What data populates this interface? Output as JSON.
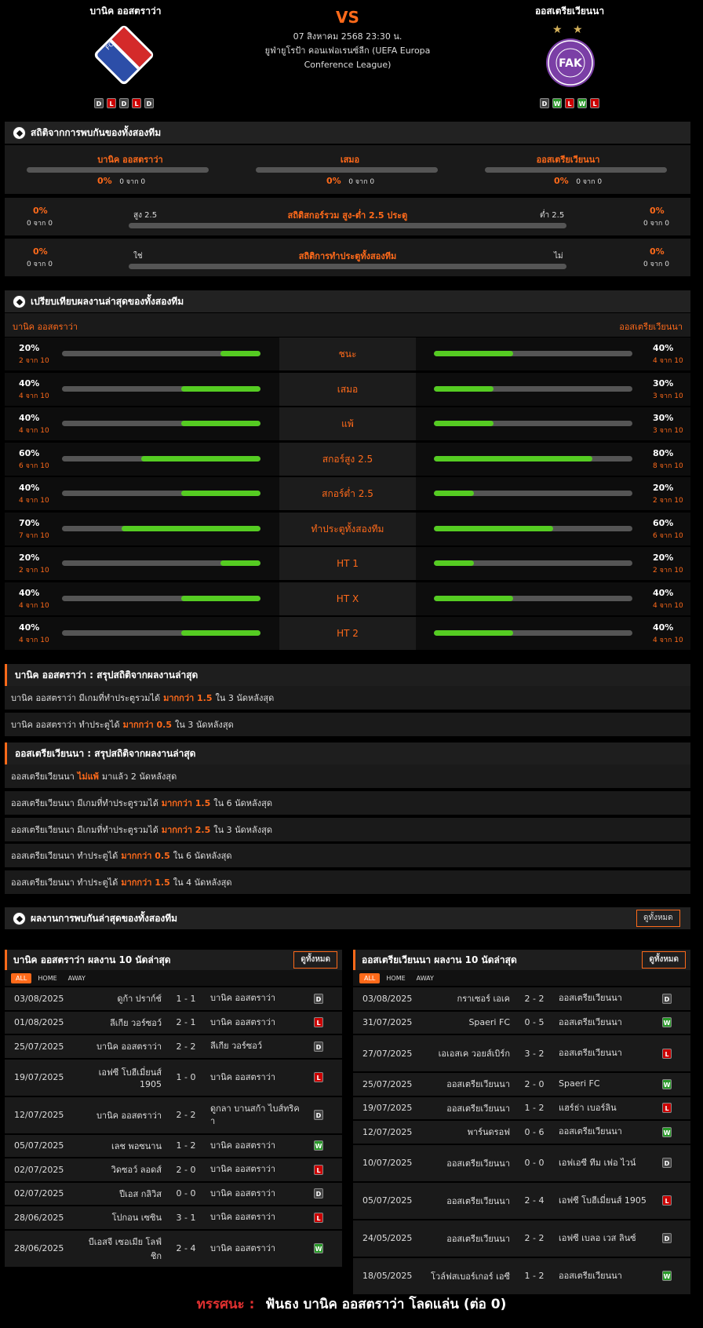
{
  "header": {
    "home_name": "บานิค ออสตราว่า",
    "away_name": "ออสเตรียเวียนนา",
    "vs": "VS",
    "date": "07 สิงหาคม 2568 23:30 น.",
    "league": "ยูฟ่ายูโรป้า คอนเฟอเรนซ์ลีก (UEFA Europa Conference League)",
    "home_form": [
      "D",
      "L",
      "D",
      "L",
      "D"
    ],
    "away_form": [
      "D",
      "W",
      "L",
      "W",
      "L"
    ],
    "home_logo_text": "FC BANÍK OSTRAVA",
    "away_logo_text": "FAK"
  },
  "h2h": {
    "title": "สถิติจากการพบกันของทั้งสองทีม",
    "home_label": "บานิค ออสตราว่า",
    "draw_label": "เสมอ",
    "away_label": "ออสเตรียเวียนนา",
    "home_pct": "0%",
    "home_cnt": "0 จาก 0",
    "draw_pct": "0%",
    "draw_cnt": "0 จาก 0",
    "away_pct": "0%",
    "away_cnt": "0 จาก 0",
    "ou": {
      "title": "สถิติสกอร์รวม สูง-ต่ำ 2.5 ประตู",
      "left_pct": "0%",
      "left_cnt": "0 จาก 0",
      "right_pct": "0%",
      "right_cnt": "0 จาก 0",
      "left_lbl": "สูง 2.5",
      "right_lbl": "ต่ำ 2.5"
    },
    "btts": {
      "title": "สถิติการทำประตูทั้งสองทีม",
      "left_pct": "0%",
      "left_cnt": "0 จาก 0",
      "right_pct": "0%",
      "right_cnt": "0 จาก 0",
      "left_lbl": "ใช่",
      "right_lbl": "ไม่"
    }
  },
  "compare": {
    "title": "เปรียบเทียบผลงานล่าสุดของทั้งสองทีม",
    "home": "บานิค ออสตราว่า",
    "away": "ออสเตรียเวียนนา",
    "rows": [
      {
        "label": "ชนะ",
        "lp": "20%",
        "lc": "2 จาก 10",
        "lv": 0.2,
        "rp": "40%",
        "rc": "4 จาก 10",
        "rv": 0.4
      },
      {
        "label": "เสมอ",
        "lp": "40%",
        "lc": "4 จาก 10",
        "lv": 0.4,
        "rp": "30%",
        "rc": "3 จาก 10",
        "rv": 0.3
      },
      {
        "label": "แพ้",
        "lp": "40%",
        "lc": "4 จาก 10",
        "lv": 0.4,
        "rp": "30%",
        "rc": "3 จาก 10",
        "rv": 0.3
      },
      {
        "label": "สกอร์สูง 2.5",
        "lp": "60%",
        "lc": "6 จาก 10",
        "lv": 0.6,
        "rp": "80%",
        "rc": "8 จาก 10",
        "rv": 0.8
      },
      {
        "label": "สกอร์ต่ำ 2.5",
        "lp": "40%",
        "lc": "4 จาก 10",
        "lv": 0.4,
        "rp": "20%",
        "rc": "2 จาก 10",
        "rv": 0.2
      },
      {
        "label": "ทำประตูทั้งสองทีม",
        "lp": "70%",
        "lc": "7 จาก 10",
        "lv": 0.7,
        "rp": "60%",
        "rc": "6 จาก 10",
        "rv": 0.6
      },
      {
        "label": "HT 1",
        "lp": "20%",
        "lc": "2 จาก 10",
        "lv": 0.2,
        "rp": "20%",
        "rc": "2 จาก 10",
        "rv": 0.2
      },
      {
        "label": "HT X",
        "lp": "40%",
        "lc": "4 จาก 10",
        "lv": 0.4,
        "rp": "40%",
        "rc": "4 จาก 10",
        "rv": 0.4
      },
      {
        "label": "HT 2",
        "lp": "40%",
        "lc": "4 จาก 10",
        "lv": 0.4,
        "rp": "40%",
        "rc": "4 จาก 10",
        "rv": 0.4
      }
    ]
  },
  "summary_home": {
    "title": "บานิค ออสตราว่า : สรุปสถิติจากผลงานล่าสุด",
    "rows": [
      {
        "a": "บานิค ออสตราว่า มีเกมที่ทำประตูรวมได้",
        "b": "มากกว่า 1.5",
        "c": "ใน 3 นัดหลังสุด"
      },
      {
        "a": "บานิค ออสตราว่า ทำประตูได้",
        "b": "มากกว่า 0.5",
        "c": "ใน 3 นัดหลังสุด"
      }
    ]
  },
  "summary_away": {
    "title": "ออสเตรียเวียนนา : สรุปสถิติจากผลงานล่าสุด",
    "rows": [
      {
        "a": "ออสเตรียเวียนนา",
        "b": "ไม่แพ้",
        "c": "มาแล้ว 2 นัดหลังสุด"
      },
      {
        "a": "ออสเตรียเวียนนา มีเกมที่ทำประตูรวมได้",
        "b": "มากกว่า 1.5",
        "c": "ใน 6 นัดหลังสุด"
      },
      {
        "a": "ออสเตรียเวียนนา มีเกมที่ทำประตูรวมได้",
        "b": "มากกว่า 2.5",
        "c": "ใน 3 นัดหลังสุด"
      },
      {
        "a": "ออสเตรียเวียนนา ทำประตูได้",
        "b": "มากกว่า 0.5",
        "c": "ใน 6 นัดหลังสุด"
      },
      {
        "a": "ออสเตรียเวียนนา ทำประตูได้",
        "b": "มากกว่า 1.5",
        "c": "ใน 4 นัดหลังสุด"
      }
    ]
  },
  "last_h2h": {
    "title": "ผลงานการพบกันล่าสุดของทั้งสองทีม",
    "btn": "ดูทั้งหมด"
  },
  "tabs": [
    "ALL",
    "HOME",
    "AWAY"
  ],
  "home_last": {
    "title": "บานิค ออสตราว่า ผลงาน 10 นัดล่าสุด",
    "btn": "ดูทั้งหมด",
    "rows": [
      {
        "d": "03/08/2025",
        "h": "ดูก้า ปราก์ช์",
        "s": "1 - 1",
        "a": "บานิค ออสตราว่า",
        "r": "D"
      },
      {
        "d": "01/08/2025",
        "h": "ลีเกีย วอร์ซอว์",
        "s": "2 - 1",
        "a": "บานิค ออสตราว่า",
        "r": "L"
      },
      {
        "d": "25/07/2025",
        "h": "บานิค ออสตราว่า",
        "s": "2 - 2",
        "a": "ลีเกีย วอร์ซอว์",
        "r": "D"
      },
      {
        "d": "19/07/2025",
        "h": "เอฟซี โบฮีเมี่ยนส์ 1905",
        "s": "1 - 0",
        "a": "บานิค ออสตราว่า",
        "r": "L"
      },
      {
        "d": "12/07/2025",
        "h": "บานิค ออสตราว่า",
        "s": "2 - 2",
        "a": "ดูกลา บานสก้า ไบส์ทริคา",
        "r": "D"
      },
      {
        "d": "05/07/2025",
        "h": "เลช พอซนาน",
        "s": "1 - 2",
        "a": "บานิค ออสตราว่า",
        "r": "W"
      },
      {
        "d": "02/07/2025",
        "h": "วิดซอว์ ลอดส์",
        "s": "2 - 0",
        "a": "บานิค ออสตราว่า",
        "r": "L"
      },
      {
        "d": "02/07/2025",
        "h": "ปีเอส กลิวิส",
        "s": "0 - 0",
        "a": "บานิค ออสตราว่า",
        "r": "D"
      },
      {
        "d": "28/06/2025",
        "h": "โปกอน เซซิน",
        "s": "3 - 1",
        "a": "บานิค ออสตราว่า",
        "r": "L"
      },
      {
        "d": "28/06/2025",
        "h": "บีเอสจี เซอเมีย โลฟ์ ชิก",
        "s": "2 - 4",
        "a": "บานิค ออสตราว่า",
        "r": "W"
      }
    ]
  },
  "away_last": {
    "title": "ออสเตรียเวียนนา ผลงาน 10 นัดล่าสุด",
    "btn": "ดูทั้งหมด",
    "rows": [
      {
        "d": "03/08/2025",
        "h": "กราเซอร์ เอเค",
        "s": "2 - 2",
        "a": "ออสเตรียเวียนนา",
        "r": "D"
      },
      {
        "d": "31/07/2025",
        "h": "Spaeri FC",
        "s": "0 - 5",
        "a": "ออสเตรียเวียนนา",
        "r": "W"
      },
      {
        "d": "27/07/2025",
        "h": "เอเอสเค วอยส์เบิร์ก",
        "s": "3 - 2",
        "a": "ออสเตรียเวียนนา",
        "r": "L"
      },
      {
        "d": "25/07/2025",
        "h": "ออสเตรียเวียนนา",
        "s": "2 - 0",
        "a": "Spaeri FC",
        "r": "W"
      },
      {
        "d": "19/07/2025",
        "h": "ออสเตรียเวียนนา",
        "s": "1 - 2",
        "a": "แฮร์ธ่า เบอร์ลิน",
        "r": "L"
      },
      {
        "d": "12/07/2025",
        "h": "พาร์นดรอฟ",
        "s": "0 - 6",
        "a": "ออสเตรียเวียนนา",
        "r": "W"
      },
      {
        "d": "10/07/2025",
        "h": "ออสเตรียเวียนนา",
        "s": "0 - 0",
        "a": "เอฟเอซี ทีม เฟอ ไวน์",
        "r": "D"
      },
      {
        "d": "05/07/2025",
        "h": "ออสเตรียเวียนนา",
        "s": "2 - 4",
        "a": "เอฟซี โบฮีเมี่ยนส์ 1905",
        "r": "L"
      },
      {
        "d": "24/05/2025",
        "h": "ออสเตรียเวียนนา",
        "s": "2 - 2",
        "a": "เอฟซี เบลอ เวส ลินซ์",
        "r": "D"
      },
      {
        "d": "18/05/2025",
        "h": "โวล์ฟสเบอร์เกอร์ เอซี",
        "s": "1 - 2",
        "a": "ออสเตรียเวียนนา",
        "r": "W"
      }
    ]
  },
  "verdict": {
    "label": "ทรรศนะ :",
    "text": "ฟันธง บานิค ออสตราว่า โลดแล่น (ต่อ 0)"
  },
  "colors": {
    "accent": "#ff6a1a",
    "bar_fill": "#55cc22",
    "win": "#2a9a2a",
    "loss": "#c00",
    "draw": "#444"
  }
}
